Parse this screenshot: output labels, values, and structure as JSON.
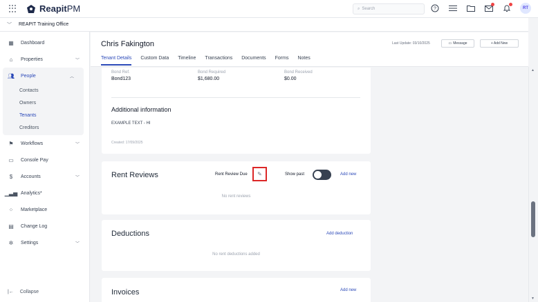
{
  "app": {
    "logo_name": "Reapit",
    "logo_suffix": "PM"
  },
  "topbar": {
    "search_placeholder": "Search",
    "avatar_initials": "RT"
  },
  "office": {
    "name": "REAPIT Training Office"
  },
  "sidebar": {
    "items": [
      {
        "label": "Dashboard"
      },
      {
        "label": "Properties"
      },
      {
        "label": "People"
      },
      {
        "label": "Workflows"
      },
      {
        "label": "Console Pay"
      },
      {
        "label": "Accounts"
      },
      {
        "label": "Analytics*"
      },
      {
        "label": "Marketplace"
      },
      {
        "label": "Change Log"
      },
      {
        "label": "Settings"
      }
    ],
    "people_sub": [
      "Contacts",
      "Owners",
      "Tenants",
      "Creditors"
    ],
    "collapse_label": "Collapse"
  },
  "header": {
    "name": "Chris Fakington",
    "last_update": "Last Update: 03/10/2025",
    "message_btn": "Message",
    "add_new_btn": "+ Add New",
    "tabs": [
      "Tenant Details",
      "Custom Data",
      "Timeline",
      "Transactions",
      "Documents",
      "Forms",
      "Notes"
    ]
  },
  "bond": {
    "ref_label": "Bond Ref.",
    "ref_value": "Bond123",
    "required_label": "Bond Required",
    "required_value": "$1,680.00",
    "received_label": "Bond Received",
    "received_value": "$0.00"
  },
  "additional": {
    "title": "Additional information",
    "text": "EXAMPLE TEXT - HI",
    "created": "Created: 17/09/2025"
  },
  "rent_reviews": {
    "title": "Rent Reviews",
    "due_label": "Rent Review Due",
    "show_past_label": "Show past",
    "add_new": "Add new",
    "empty": "No rent reviews"
  },
  "deductions": {
    "title": "Deductions",
    "add": "Add deduction",
    "empty": "No rent deductions added"
  },
  "invoices": {
    "title": "Invoices",
    "add_new": "Add new"
  },
  "colors": {
    "accent": "#2b49b8",
    "highlight_box": "#dc2626"
  }
}
